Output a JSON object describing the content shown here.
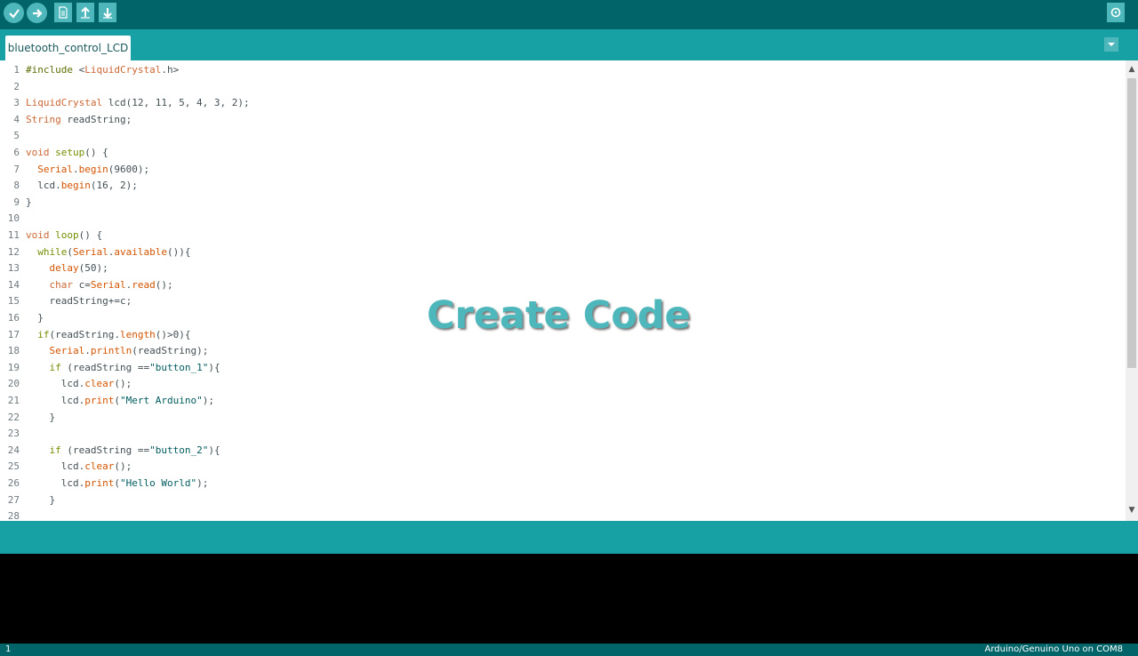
{
  "toolbar": {
    "buttons": [
      {
        "name": "verify",
        "icon": "check-icon"
      },
      {
        "name": "upload",
        "icon": "arrow-right-icon"
      },
      {
        "name": "new",
        "icon": "document-icon"
      },
      {
        "name": "open",
        "icon": "arrow-up-icon"
      },
      {
        "name": "save",
        "icon": "arrow-down-icon"
      },
      {
        "name": "serial-monitor",
        "icon": "magnifier-icon"
      }
    ]
  },
  "tabs": [
    {
      "label": "bluetooth_control_LCD"
    }
  ],
  "editor": {
    "lines": [
      {
        "n": "1",
        "segs": [
          {
            "t": "#include ",
            "c": "kw-pre"
          },
          {
            "t": "<",
            "c": ""
          },
          {
            "t": "LiquidCrystal",
            "c": "kw-type"
          },
          {
            "t": ".h>",
            "c": ""
          }
        ]
      },
      {
        "n": "2",
        "segs": []
      },
      {
        "n": "3",
        "segs": [
          {
            "t": "LiquidCrystal",
            "c": "kw-type"
          },
          {
            "t": " lcd(12, 11, 5, 4, 3, 2);",
            "c": ""
          }
        ]
      },
      {
        "n": "4",
        "segs": [
          {
            "t": "String",
            "c": "kw-type"
          },
          {
            "t": " readString;",
            "c": ""
          }
        ]
      },
      {
        "n": "5",
        "segs": []
      },
      {
        "n": "6",
        "segs": [
          {
            "t": "void",
            "c": "kw-type"
          },
          {
            "t": " ",
            "c": ""
          },
          {
            "t": "setup",
            "c": "kw-ctrl"
          },
          {
            "t": "() {",
            "c": ""
          }
        ]
      },
      {
        "n": "7",
        "segs": [
          {
            "t": "  ",
            "c": ""
          },
          {
            "t": "Serial",
            "c": "kw-fn"
          },
          {
            "t": ".",
            "c": ""
          },
          {
            "t": "begin",
            "c": "kw-fn"
          },
          {
            "t": "(9600);",
            "c": ""
          }
        ]
      },
      {
        "n": "8",
        "segs": [
          {
            "t": "  lcd.",
            "c": ""
          },
          {
            "t": "begin",
            "c": "kw-fn"
          },
          {
            "t": "(16, 2);",
            "c": ""
          }
        ]
      },
      {
        "n": "9",
        "segs": [
          {
            "t": "}",
            "c": ""
          }
        ]
      },
      {
        "n": "10",
        "segs": []
      },
      {
        "n": "11",
        "segs": [
          {
            "t": "void",
            "c": "kw-type"
          },
          {
            "t": " ",
            "c": ""
          },
          {
            "t": "loop",
            "c": "kw-ctrl"
          },
          {
            "t": "() {",
            "c": ""
          }
        ]
      },
      {
        "n": "12",
        "segs": [
          {
            "t": "  ",
            "c": ""
          },
          {
            "t": "while",
            "c": "kw-ctrl"
          },
          {
            "t": "(",
            "c": ""
          },
          {
            "t": "Serial",
            "c": "kw-fn"
          },
          {
            "t": ".",
            "c": ""
          },
          {
            "t": "available",
            "c": "kw-fn"
          },
          {
            "t": "()){",
            "c": ""
          }
        ]
      },
      {
        "n": "13",
        "segs": [
          {
            "t": "    ",
            "c": ""
          },
          {
            "t": "delay",
            "c": "kw-fn"
          },
          {
            "t": "(50);",
            "c": ""
          }
        ]
      },
      {
        "n": "14",
        "segs": [
          {
            "t": "    ",
            "c": ""
          },
          {
            "t": "char",
            "c": "kw-type"
          },
          {
            "t": " c=",
            "c": ""
          },
          {
            "t": "Serial",
            "c": "kw-fn"
          },
          {
            "t": ".",
            "c": ""
          },
          {
            "t": "read",
            "c": "kw-fn"
          },
          {
            "t": "();",
            "c": ""
          }
        ]
      },
      {
        "n": "15",
        "segs": [
          {
            "t": "    readString+=c;",
            "c": ""
          }
        ]
      },
      {
        "n": "16",
        "segs": [
          {
            "t": "  }",
            "c": ""
          }
        ]
      },
      {
        "n": "17",
        "segs": [
          {
            "t": "  ",
            "c": ""
          },
          {
            "t": "if",
            "c": "kw-ctrl"
          },
          {
            "t": "(readString.",
            "c": ""
          },
          {
            "t": "length",
            "c": "kw-fn"
          },
          {
            "t": "()>0){",
            "c": ""
          }
        ]
      },
      {
        "n": "18",
        "segs": [
          {
            "t": "    ",
            "c": ""
          },
          {
            "t": "Serial",
            "c": "kw-fn"
          },
          {
            "t": ".",
            "c": ""
          },
          {
            "t": "println",
            "c": "kw-fn"
          },
          {
            "t": "(readString);",
            "c": ""
          }
        ]
      },
      {
        "n": "19",
        "segs": [
          {
            "t": "    ",
            "c": ""
          },
          {
            "t": "if",
            "c": "kw-ctrl"
          },
          {
            "t": " (readString ==",
            "c": ""
          },
          {
            "t": "\"button_1\"",
            "c": "str"
          },
          {
            "t": "){",
            "c": ""
          }
        ]
      },
      {
        "n": "20",
        "segs": [
          {
            "t": "      lcd.",
            "c": ""
          },
          {
            "t": "clear",
            "c": "kw-fn"
          },
          {
            "t": "();",
            "c": ""
          }
        ]
      },
      {
        "n": "21",
        "segs": [
          {
            "t": "      lcd.",
            "c": ""
          },
          {
            "t": "print",
            "c": "kw-fn"
          },
          {
            "t": "(",
            "c": ""
          },
          {
            "t": "\"Mert Arduino\"",
            "c": "str"
          },
          {
            "t": ");",
            "c": ""
          }
        ]
      },
      {
        "n": "22",
        "segs": [
          {
            "t": "    }",
            "c": ""
          }
        ]
      },
      {
        "n": "23",
        "segs": []
      },
      {
        "n": "24",
        "segs": [
          {
            "t": "    ",
            "c": ""
          },
          {
            "t": "if",
            "c": "kw-ctrl"
          },
          {
            "t": " (readString ==",
            "c": ""
          },
          {
            "t": "\"button_2\"",
            "c": "str"
          },
          {
            "t": "){",
            "c": ""
          }
        ]
      },
      {
        "n": "25",
        "segs": [
          {
            "t": "      lcd.",
            "c": ""
          },
          {
            "t": "clear",
            "c": "kw-fn"
          },
          {
            "t": "();",
            "c": ""
          }
        ]
      },
      {
        "n": "26",
        "segs": [
          {
            "t": "      lcd.",
            "c": ""
          },
          {
            "t": "print",
            "c": "kw-fn"
          },
          {
            "t": "(",
            "c": ""
          },
          {
            "t": "\"Hello World\"",
            "c": "str"
          },
          {
            "t": ");",
            "c": ""
          }
        ]
      },
      {
        "n": "27",
        "segs": [
          {
            "t": "    }",
            "c": ""
          }
        ]
      },
      {
        "n": "28",
        "segs": []
      }
    ]
  },
  "overlay": {
    "text": "Create Code"
  },
  "status": {
    "line": "1",
    "board": "Arduino/Genuino Uno on COM8"
  },
  "colors": {
    "toolbar": "#006468",
    "tabbar": "#17a1a5",
    "button": "#4db7bb"
  }
}
